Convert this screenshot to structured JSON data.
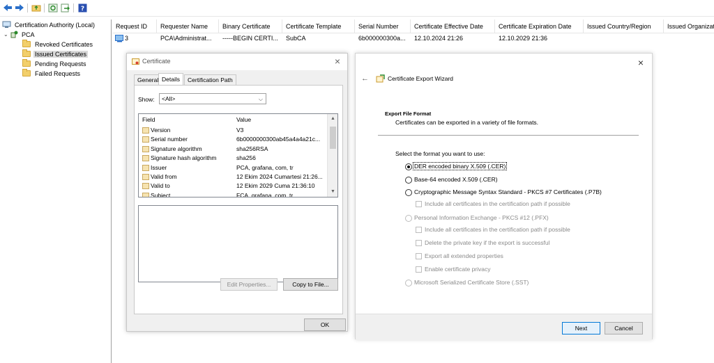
{
  "tree": {
    "root": "Certification Authority (Local)",
    "ca": "PCA",
    "items": [
      "Revoked Certificates",
      "Issued Certificates",
      "Pending Requests",
      "Failed Requests"
    ],
    "selected_index": 1
  },
  "grid": {
    "columns": [
      "Request ID",
      "Requester Name",
      "Binary Certificate",
      "Certificate Template",
      "Serial Number",
      "Certificate Effective Date",
      "Certificate Expiration Date",
      "Issued Country/Region",
      "Issued Organizat"
    ],
    "rows": [
      [
        "3",
        "PCA\\Administrat...",
        "-----BEGIN CERTI...",
        "SubCA",
        "6b000000300a...",
        "12.10.2024 21:26",
        "12.10.2029 21:36",
        "",
        ""
      ]
    ]
  },
  "cert_dialog": {
    "title": "Certificate",
    "tabs": [
      "General",
      "Details",
      "Certification Path"
    ],
    "active_tab": 1,
    "show_label": "Show:",
    "show_value": "<All>",
    "field_header": "Field",
    "value_header": "Value",
    "fields": [
      {
        "name": "Version",
        "value": "V3"
      },
      {
        "name": "Serial number",
        "value": "6b0000000300ab45a4a4a21c..."
      },
      {
        "name": "Signature algorithm",
        "value": "sha256RSA"
      },
      {
        "name": "Signature hash algorithm",
        "value": "sha256"
      },
      {
        "name": "Issuer",
        "value": "PCA, grafana, com, tr"
      },
      {
        "name": "Valid from",
        "value": "12 Ekim 2024 Cumartesi 21:26..."
      },
      {
        "name": "Valid to",
        "value": "12 Ekim 2029 Cuma 21:36:10"
      },
      {
        "name": "Subject",
        "value": "FCA, grafana, com, tr"
      }
    ],
    "edit_properties": "Edit Properties...",
    "copy_to_file": "Copy to File...",
    "ok": "OK"
  },
  "wizard": {
    "title": "Certificate Export Wizard",
    "section_title": "Export File Format",
    "section_desc": "Certificates can be exported in a variety of file formats.",
    "prompt": "Select the format you want to use:",
    "options": [
      {
        "label": "DER encoded binary X.509 (.CER)",
        "checked": true,
        "enabled": true
      },
      {
        "label": "Base-64 encoded X.509 (.CER)",
        "checked": false,
        "enabled": true
      },
      {
        "label": "Cryptographic Message Syntax Standard - PKCS #7 Certificates (.P7B)",
        "checked": false,
        "enabled": true
      },
      {
        "label": "Personal Information Exchange - PKCS #12 (.PFX)",
        "checked": false,
        "enabled": false
      },
      {
        "label": "Microsoft Serialized Certificate Store (.SST)",
        "checked": false,
        "enabled": false
      }
    ],
    "p7b_checkbox": "Include all certificates in the certification path if possible",
    "pfx_checkboxes": [
      "Include all certificates in the certification path if possible",
      "Delete the private key if the export is successful",
      "Export all extended properties",
      "Enable certificate privacy"
    ],
    "next": "Next",
    "cancel": "Cancel"
  },
  "colors": {
    "selection": "#d9d9d9",
    "default_button_border": "#0078d7",
    "folder": "#f2cf6b"
  }
}
